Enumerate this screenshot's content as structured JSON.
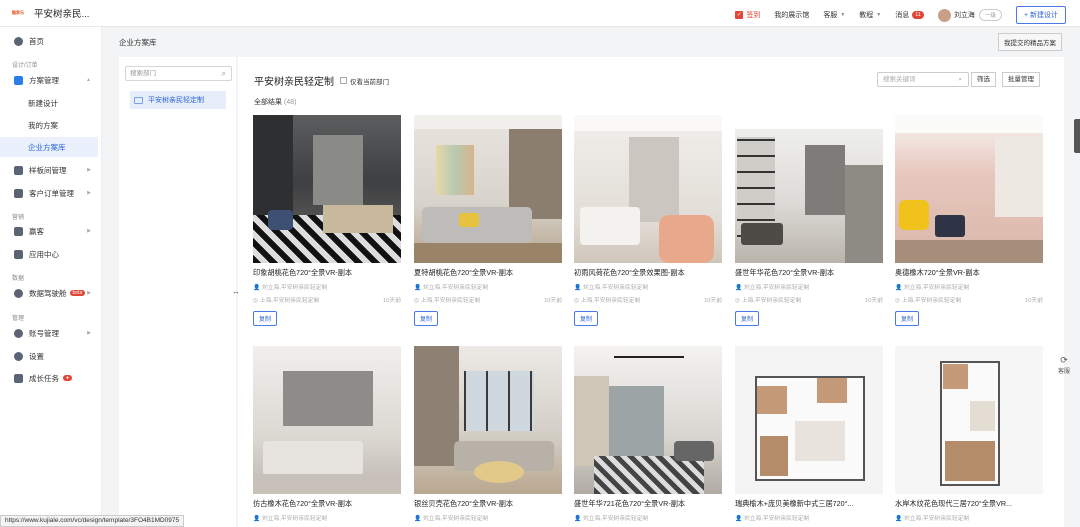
{
  "brand": {
    "logo_text": "酷家乐",
    "name": "平安树亲民..."
  },
  "topbar": {
    "signin": "签到",
    "showroom": "我的展示馆",
    "service": "客服",
    "tutorial": "教程",
    "messages": "消息",
    "message_count": "11",
    "user": "刘立海",
    "user_tag": "一级",
    "new_design": "+ 新建设计"
  },
  "sidebar": {
    "home": "首页",
    "group_design": "设计/订单",
    "plan_mgmt": "方案管理",
    "new_design": "新建设计",
    "my_plans": "我的方案",
    "company_plans": "企业方案库",
    "model_mgmt": "样板间管理",
    "orders": "客户订单管理",
    "group_marketing": "营销",
    "promo": "赢客",
    "apps": "应用中心",
    "group_data": "数据",
    "data_cockpit": "数据驾驶舱",
    "beta": "beta",
    "group_manage": "管理",
    "accounts": "账号管理",
    "settings": "设置",
    "growth": "成长任务"
  },
  "content": {
    "breadcrumb": "企业方案库",
    "my_submitted": "我提交的精品方案",
    "dept_search_placeholder": "搜索部门",
    "dept_item": "平安树亲民轻定制",
    "title": "平安树亲民轻定制",
    "only_current": "仅看当前部门",
    "result_label": "全部结果",
    "result_count": "(48)",
    "keyword_placeholder": "搜索关键词",
    "filter": "筛选",
    "batch": "批量管理",
    "copy": "复制",
    "feedback": "客服"
  },
  "cards": [
    {
      "title": "印象胡桃花色720&deg;全景VR-副本",
      "meta": "刘立海,平安树亲民轻定制",
      "loc": "上海,平安树亲民轻定制",
      "time": "10天前",
      "scene": "dark"
    },
    {
      "title": "夏特胡桃花色720&deg;全景VR-副本",
      "meta": "刘立海,平安树亲民轻定制",
      "loc": "上海,平安树亲民轻定制",
      "time": "10天前",
      "scene": "living"
    },
    {
      "title": "初雨风荷花色720&deg;全景效果图-副本",
      "meta": "刘立海,平安树亲民轻定制",
      "loc": "上海,平安树亲民轻定制",
      "time": "10天前",
      "scene": "white"
    },
    {
      "title": "盛世年华花色720&deg;全景VR-副本",
      "meta": "刘立海,平安树亲民轻定制",
      "loc": "上海,平安树亲民轻定制",
      "time": "10天前",
      "scene": "corridor"
    },
    {
      "title": "奥德橡木720&deg;全景VR-副本",
      "meta": "刘立海,平安树亲民轻定制",
      "loc": "上海,平安树亲民轻定制",
      "time": "10天前",
      "scene": "pink"
    },
    {
      "title": "仿古橡木花色720&deg;全景VR-副本",
      "meta": "刘立海,平安树亲民轻定制",
      "scene": "grey"
    },
    {
      "title": "银丝贝壳花色720&deg;全景VR-副本",
      "meta": "刘立海,平安树亲民轻定制",
      "scene": "window"
    },
    {
      "title": "盛世年华721花色720&deg;全景VR-副本",
      "meta": "刘立海,平安树亲民轻定制",
      "scene": "lounge"
    },
    {
      "title": "瑞典榆木+庞贝美橡新中式三居720&deg;...",
      "meta": "刘立海,平安树亲民轻定制",
      "scene": "plan"
    },
    {
      "title": "水岸木纹花色现代三居720&deg;全景VR...",
      "meta": "刘立海,平安树亲民轻定制",
      "scene": "plan2"
    }
  ],
  "statusbar": "https://www.kujiale.com/vc/design/template/3FO4B1MD0975"
}
